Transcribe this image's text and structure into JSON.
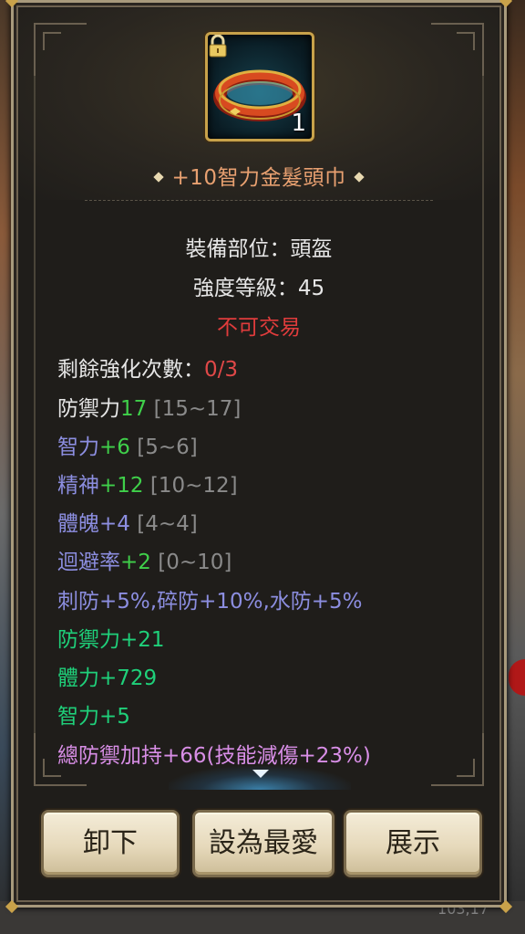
{
  "background": {
    "coordinate_text": "103,17"
  },
  "item": {
    "icon": "gold-headband-ring-icon",
    "locked": true,
    "stack_count": "1",
    "name": "+10智力金髮頭巾",
    "name_color": "#e8a070"
  },
  "info": {
    "slot": "裝備部位：頭盔",
    "strength_level": "強度等級：45",
    "trade_status": "不可交易"
  },
  "stats": {
    "enhance_label": "剩餘強化次數：",
    "enhance_value": "0/3",
    "def_label": "防禦力",
    "def_value": "17",
    "def_range": "[15~17]",
    "int_label": "智力",
    "int_value": "+6",
    "int_range": "[5~6]",
    "spirit_label": "精神",
    "spirit_value": "+12",
    "spirit_range": "[10~12]",
    "phys_label": "體魄",
    "phys_value": "+4",
    "phys_range": "[4~4]",
    "evade_label": "迴避率",
    "evade_value": "+2",
    "evade_range": "[0~10]",
    "resist": "刺防+5%,碎防+10%,水防+5%",
    "bonus_def": "防禦力+21",
    "bonus_hp": "體力+729",
    "bonus_int": "智力+5",
    "total_def": "總防禦加持+66(技能減傷+23%)"
  },
  "buttons": {
    "unequip": "卸下",
    "favorite": "設為最愛",
    "showcase": "展示"
  },
  "colors": {
    "green": "#3fd04a",
    "lavender": "#8c8ee0",
    "teal": "#1fd07a",
    "pink": "#d88ee6",
    "red": "#e03c3c"
  }
}
